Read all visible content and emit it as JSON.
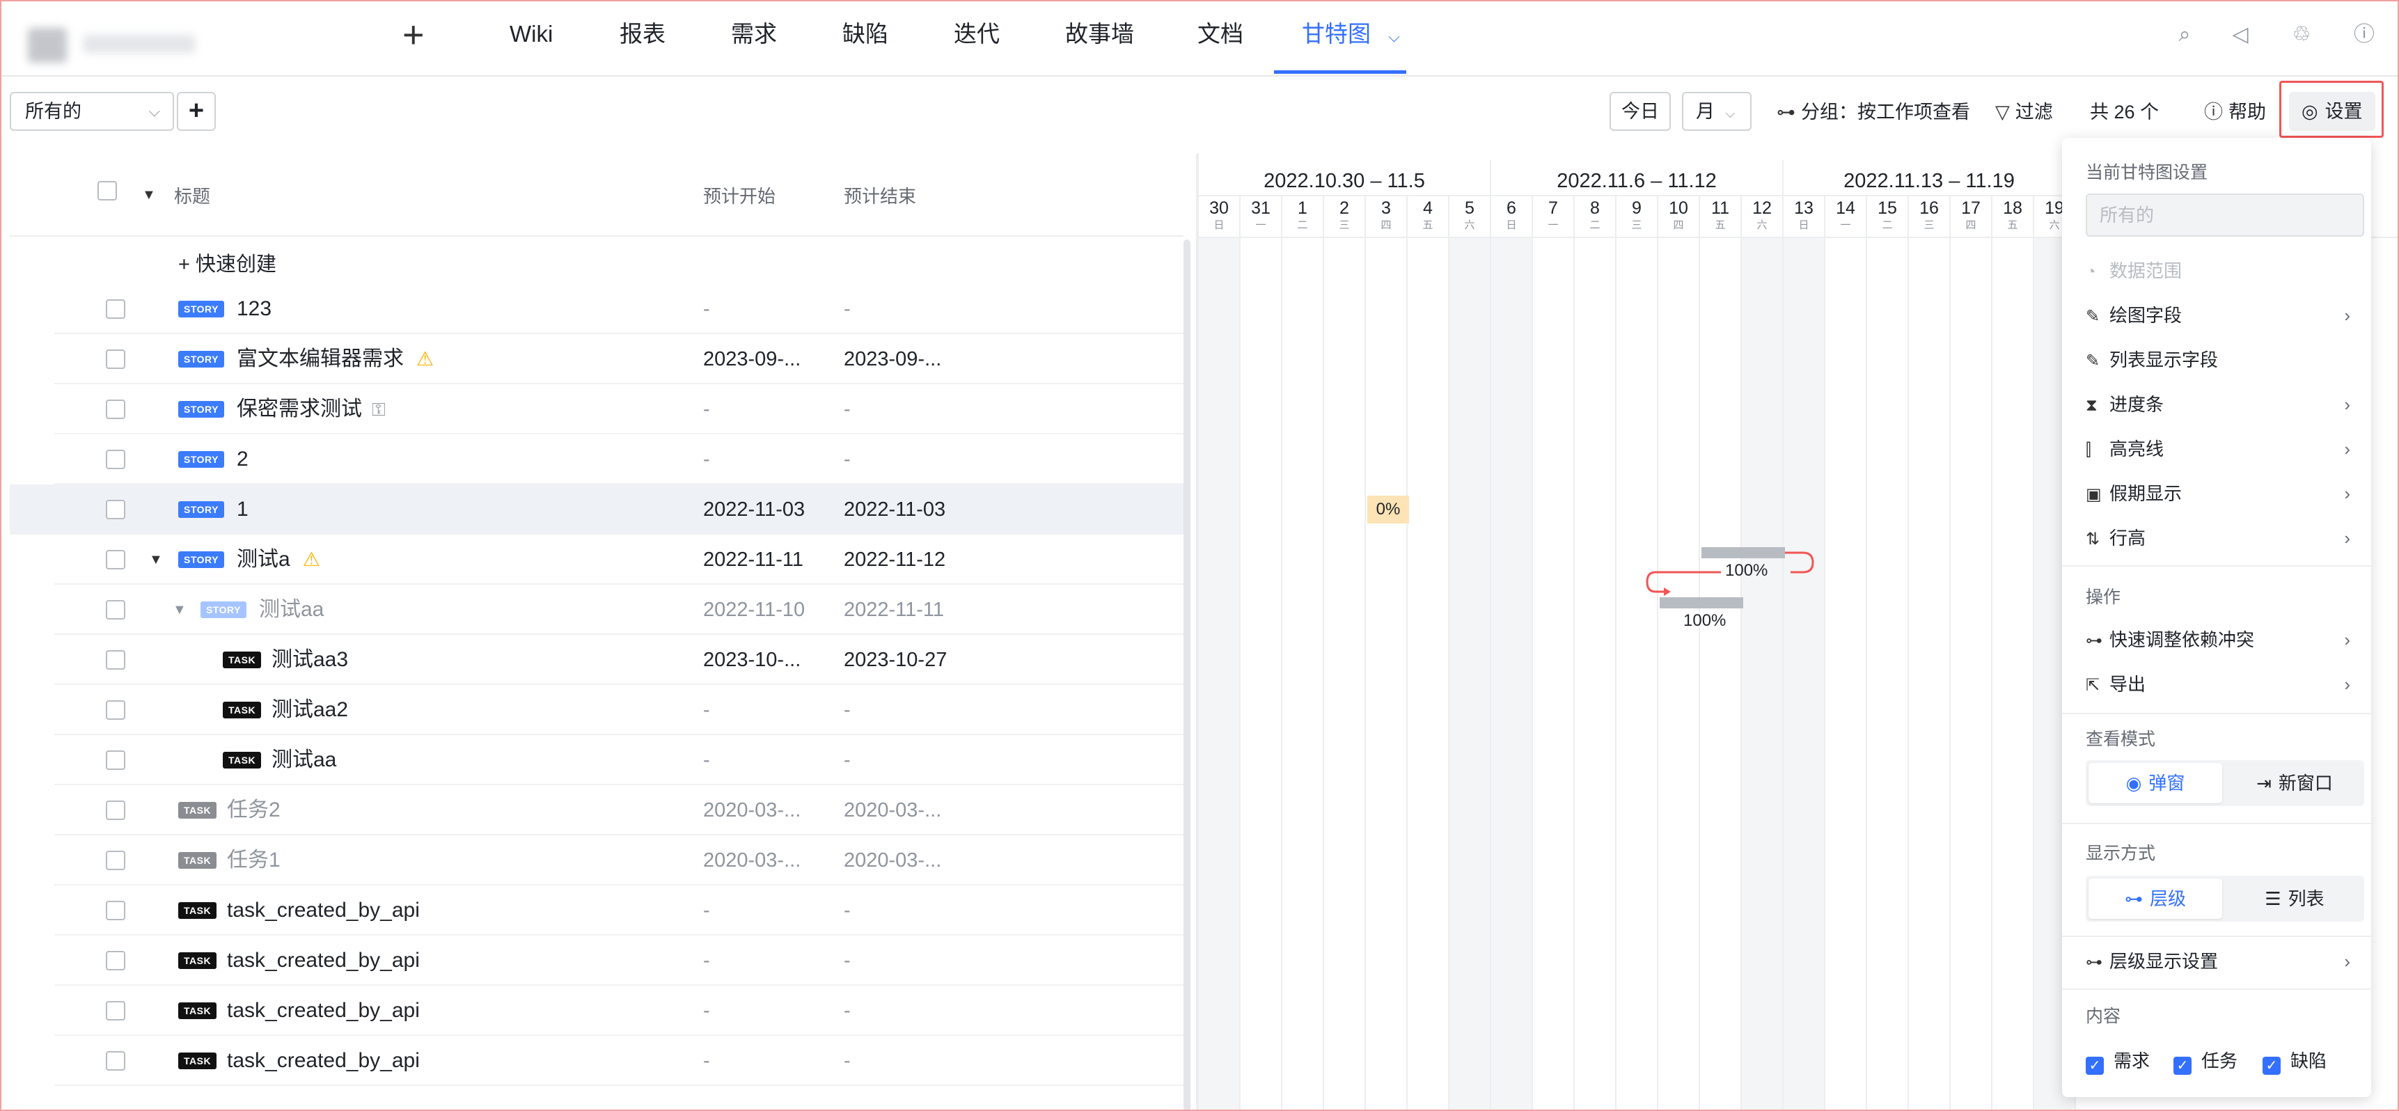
{
  "nav": {
    "items": [
      {
        "label": "Wiki"
      },
      {
        "label": "报表"
      },
      {
        "label": "需求"
      },
      {
        "label": "缺陷"
      },
      {
        "label": "迭代"
      },
      {
        "label": "故事墙"
      },
      {
        "label": "文档"
      },
      {
        "label": "甘特图"
      }
    ],
    "active": "甘特图",
    "add_symbol": "+"
  },
  "toolbar": {
    "view_select": "所有的",
    "today": "今日",
    "scale": "月",
    "group": "分组：按工作项查看",
    "filter": "过滤",
    "total": "共 26 个",
    "help": "帮助",
    "settings": "设置"
  },
  "table": {
    "headers": {
      "title": "标题",
      "start": "预计开始",
      "end": "预计结束"
    },
    "quick_create": "+ 快速创建",
    "rows": [
      {
        "type": "STORY",
        "title": "123",
        "start": "-",
        "end": "-"
      },
      {
        "type": "STORY",
        "title": "富文本编辑器需求",
        "start": "2023-09-...",
        "end": "2023-09-..."
      },
      {
        "type": "STORY",
        "title": "保密需求测试",
        "start": "-",
        "end": "-"
      },
      {
        "type": "STORY",
        "title": "2",
        "start": "-",
        "end": "-"
      },
      {
        "type": "STORY",
        "title": "1",
        "start": "2022-11-03",
        "end": "2022-11-03"
      },
      {
        "type": "STORY",
        "title": "测试a",
        "start": "2022-11-11",
        "end": "2022-11-12"
      },
      {
        "type": "STORY",
        "title": "测试aa",
        "start": "2022-11-10",
        "end": "2022-11-11"
      },
      {
        "type": "TASK",
        "title": "测试aa3",
        "start": "2023-10-...",
        "end": "2023-10-27"
      },
      {
        "type": "TASK",
        "title": "测试aa2",
        "start": "-",
        "end": "-"
      },
      {
        "type": "TASK",
        "title": "测试aa",
        "start": "-",
        "end": "-"
      },
      {
        "type": "TASK",
        "title": "任务2",
        "start": "2020-03-...",
        "end": "2020-03-..."
      },
      {
        "type": "TASK",
        "title": "任务1",
        "start": "2020-03-...",
        "end": "2020-03-..."
      },
      {
        "type": "TASK",
        "title": "task_created_by_api",
        "start": "-",
        "end": "-"
      },
      {
        "type": "TASK",
        "title": "task_created_by_api",
        "start": "-",
        "end": "-"
      },
      {
        "type": "TASK",
        "title": "task_created_by_api",
        "start": "-",
        "end": "-"
      },
      {
        "type": "TASK",
        "title": "task_created_by_api",
        "start": "-",
        "end": "-"
      }
    ]
  },
  "gantt": {
    "weeks": [
      "2022.10.30 – 11.5",
      "2022.11.6 – 11.12",
      "2022.11.13 – 11.19"
    ],
    "days": [
      {
        "n": "30",
        "w": "日"
      },
      {
        "n": "31",
        "w": "一"
      },
      {
        "n": "1",
        "w": "二"
      },
      {
        "n": "2",
        "w": "三"
      },
      {
        "n": "3",
        "w": "四"
      },
      {
        "n": "4",
        "w": "五"
      },
      {
        "n": "5",
        "w": "六"
      },
      {
        "n": "6",
        "w": "日"
      },
      {
        "n": "7",
        "w": "一"
      },
      {
        "n": "8",
        "w": "二"
      },
      {
        "n": "9",
        "w": "三"
      },
      {
        "n": "10",
        "w": "四"
      },
      {
        "n": "11",
        "w": "五"
      },
      {
        "n": "12",
        "w": "六"
      },
      {
        "n": "13",
        "w": "日"
      },
      {
        "n": "14",
        "w": "一"
      },
      {
        "n": "15",
        "w": "二"
      },
      {
        "n": "16",
        "w": "三"
      },
      {
        "n": "17",
        "w": "四"
      },
      {
        "n": "18",
        "w": "五"
      },
      {
        "n": "19",
        "w": "六"
      }
    ],
    "bars": [
      {
        "label": "0%"
      },
      {
        "label": "100%"
      },
      {
        "label": "100%"
      }
    ]
  },
  "settings_panel": {
    "current_title": "当前甘特图设置",
    "current_value": "所有的",
    "data_range": "数据范围",
    "draw_fields": "绘图字段",
    "list_fields": "列表显示字段",
    "progress_bar": "进度条",
    "highlight_line": "高亮线",
    "holiday": "假期显示",
    "row_height": "行高",
    "ops_title": "操作",
    "quick_adjust": "快速调整依赖冲突",
    "export": "导出",
    "view_mode_title": "查看模式",
    "view_popup": "弹窗",
    "view_new_window": "新窗口",
    "display_title": "显示方式",
    "display_level": "层级",
    "display_list": "列表",
    "level_settings": "层级显示设置",
    "content_title": "内容",
    "content_story": "需求",
    "content_task": "任务",
    "content_bug": "缺陷"
  }
}
